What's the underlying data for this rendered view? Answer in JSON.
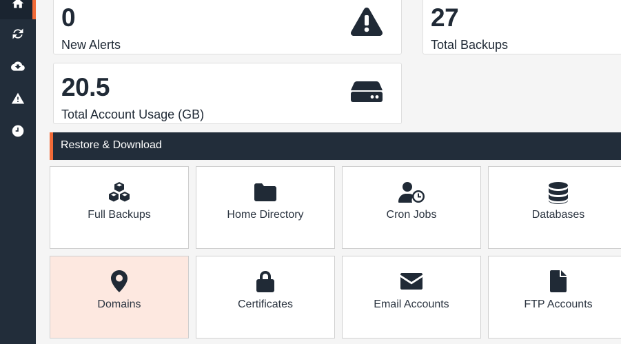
{
  "sidebar": {
    "items": [
      {
        "name": "home-icon",
        "active": true
      },
      {
        "name": "refresh-icon",
        "active": false
      },
      {
        "name": "cloud-download-icon",
        "active": false
      },
      {
        "name": "warning-icon",
        "active": false
      },
      {
        "name": "clock-icon",
        "active": false
      }
    ]
  },
  "stats": {
    "alerts": {
      "value": "0",
      "label": "New Alerts",
      "icon": "warning-icon"
    },
    "backups": {
      "value": "27",
      "label": "Total Backups"
    },
    "usage": {
      "value": "20.5",
      "label": "Total Account Usage (GB)",
      "icon": "hard-drive-icon"
    }
  },
  "section": {
    "title": "Restore & Download"
  },
  "tiles": [
    {
      "label": "Full Backups",
      "icon": "cubes-icon"
    },
    {
      "label": "Home Directory",
      "icon": "folder-icon"
    },
    {
      "label": "Cron Jobs",
      "icon": "user-clock-icon"
    },
    {
      "label": "Databases",
      "icon": "database-icon"
    },
    {
      "label": "Domains",
      "icon": "map-marker-icon",
      "highlighted": true
    },
    {
      "label": "Certificates",
      "icon": "lock-icon"
    },
    {
      "label": "Email Accounts",
      "icon": "envelope-icon"
    },
    {
      "label": "FTP Accounts",
      "icon": "file-icon"
    }
  ],
  "colors": {
    "sidebar_bg": "#222d3a",
    "accent": "#f26b38",
    "highlight_tile_bg": "#fde8e0",
    "text_dark": "#202a36"
  }
}
